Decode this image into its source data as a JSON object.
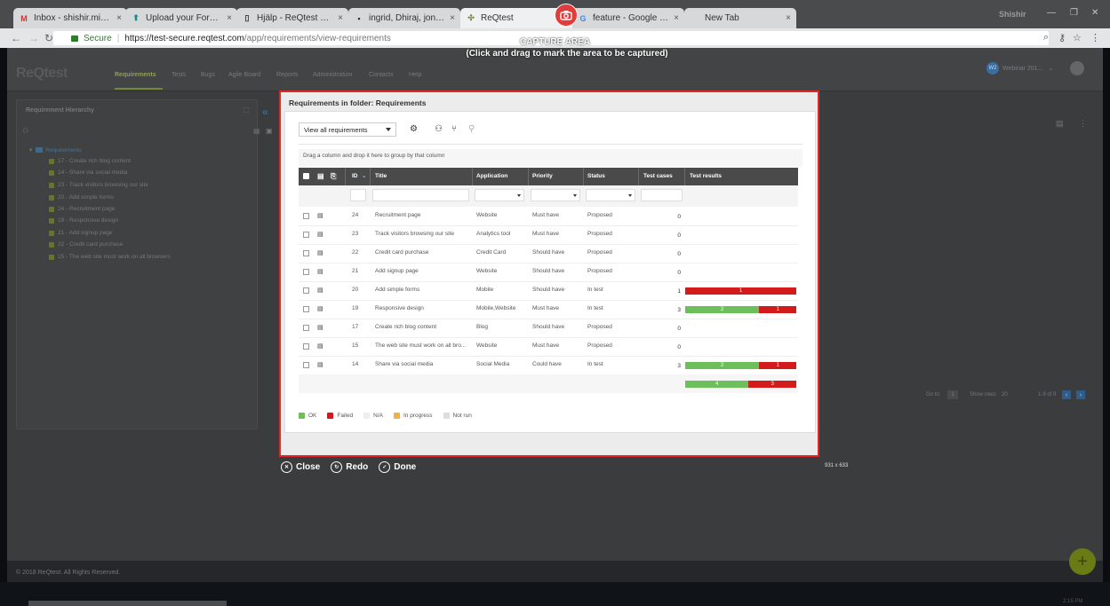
{
  "browser": {
    "tabs": [
      {
        "icon": "gmail-icon",
        "label": "Inbox - shishir.mishra@r"
      },
      {
        "icon": "upload-icon",
        "label": "Upload your Form-16 PD"
      },
      {
        "icon": "page-icon",
        "label": "Hjälp - ReQtest Help"
      },
      {
        "icon": "page-icon",
        "label": "ingrid, Dhiraj, jonas | Re"
      },
      {
        "icon": "reqtest-icon",
        "label": "ReQtest"
      },
      {
        "icon": "google-icon",
        "label": "feature - Google Search"
      },
      {
        "icon": "page-icon",
        "label": "New Tab"
      }
    ],
    "profile": "Shishir",
    "url": {
      "secure_label": "Secure",
      "host": "https://test-secure.reqtest.com",
      "path": "/app/requirements/view-requirements"
    }
  },
  "capture": {
    "title": "CAPTURE AREA",
    "subtitle": "(Click and drag to mark the area to be captured)",
    "actions": {
      "close": "Close",
      "redo": "Redo",
      "done": "Done"
    },
    "dimensions": "931 x 633"
  },
  "app": {
    "logo": "ReQtest",
    "nav": [
      "Requirements",
      "Tests",
      "Bugs",
      "Agile Board",
      "Reports",
      "Administration",
      "Contacts",
      "Help"
    ],
    "workspace": {
      "badge": "W2",
      "label": "Webinar 201..."
    },
    "left_panel_title": "Requirement Hierarchy",
    "tree": {
      "root": "Requirements",
      "items": [
        "17 - Create rich blog content",
        "14 - Share via social media",
        "23 - Track visitors browsing our site",
        "20 - Add simple forms",
        "24 - Recruitment page",
        "19 - Responsive design",
        "21 - Add signup page",
        "22 - Credit card purchase",
        "15 - The web site must work on all browsers"
      ]
    },
    "pager": {
      "goto_label": "Go to:",
      "goto_value": "1",
      "show_rows_label": "Show rows:",
      "show_rows_value": "20",
      "range": "1-9 of 9"
    },
    "footer": "© 2018 ReQtest. All Rights Reserved.",
    "clock": "2:15 PM"
  },
  "dialog": {
    "title": "Requirements in folder: Requirements",
    "view_select": "View all requirements",
    "group_hint": "Drag a column and drop it here to group by that column",
    "columns": {
      "id": "ID",
      "title": "Title",
      "application": "Application",
      "priority": "Priority",
      "status": "Status",
      "test_cases": "Test cases",
      "test_results": "Test results"
    },
    "rows": [
      {
        "id": "24",
        "title": "Recruitment page",
        "application": "Website",
        "priority": "Must have",
        "status": "Proposed",
        "test_cases": "0",
        "ok": 0,
        "failed": 0
      },
      {
        "id": "23",
        "title": "Track visitors browsing our site",
        "application": "Analytics tool",
        "priority": "Must have",
        "status": "Proposed",
        "test_cases": "0",
        "ok": 0,
        "failed": 0
      },
      {
        "id": "22",
        "title": "Credit card purchase",
        "application": "Credit Card",
        "priority": "Should have",
        "status": "Proposed",
        "test_cases": "0",
        "ok": 0,
        "failed": 0
      },
      {
        "id": "21",
        "title": "Add signup page",
        "application": "Website",
        "priority": "Should have",
        "status": "Proposed",
        "test_cases": "0",
        "ok": 0,
        "failed": 0
      },
      {
        "id": "20",
        "title": "Add simple forms",
        "application": "Mobile",
        "priority": "Should have",
        "status": "In test",
        "test_cases": "1",
        "ok": 0,
        "failed": 1
      },
      {
        "id": "19",
        "title": "Responsive design",
        "application": "Mobile,Website",
        "priority": "Must have",
        "status": "In test",
        "test_cases": "3",
        "ok": 2,
        "failed": 1
      },
      {
        "id": "17",
        "title": "Create rich blog content",
        "application": "Blog",
        "priority": "Should have",
        "status": "Proposed",
        "test_cases": "0",
        "ok": 0,
        "failed": 0
      },
      {
        "id": "15",
        "title": "The web site must work on all bro...",
        "application": "Website",
        "priority": "Must have",
        "status": "Proposed",
        "test_cases": "0",
        "ok": 0,
        "failed": 0
      },
      {
        "id": "14",
        "title": "Share via social media",
        "application": "Social Media",
        "priority": "Could have",
        "status": "In test",
        "test_cases": "3",
        "ok": 2,
        "failed": 1
      }
    ],
    "totals": {
      "ok": 4,
      "failed": 3
    },
    "legend": [
      {
        "label": "OK",
        "color": "#6cbf5b"
      },
      {
        "label": "Failed",
        "color": "#d41b1b"
      },
      {
        "label": "N/A",
        "color": "#eeeeee"
      },
      {
        "label": "In progress",
        "color": "#f5b041"
      },
      {
        "label": "Not run",
        "color": "#dddddd"
      }
    ]
  }
}
